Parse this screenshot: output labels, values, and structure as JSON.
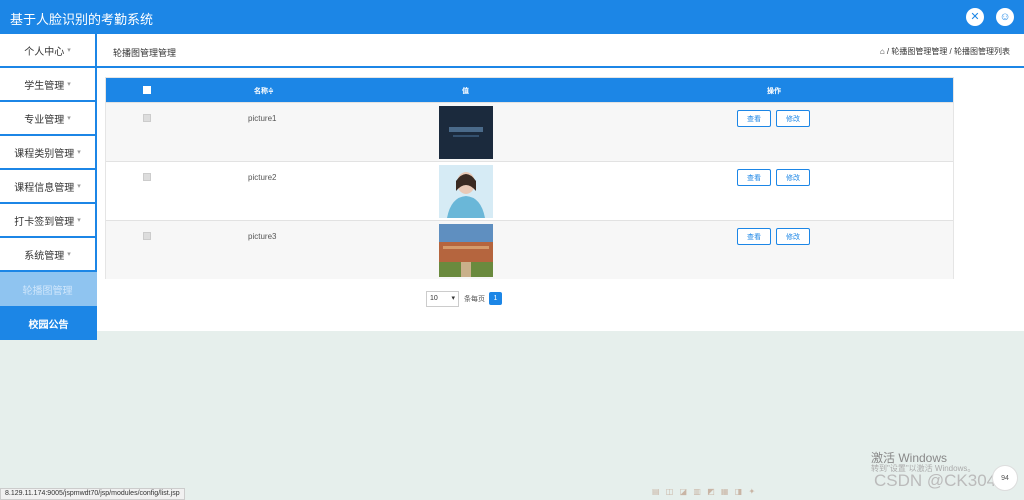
{
  "app": {
    "title": "基于人脸识别的考勤系统"
  },
  "header_icons": [
    "expand-icon",
    "user-icon"
  ],
  "sidebar": {
    "items": [
      {
        "label": "个人中心",
        "caret": "▾"
      },
      {
        "label": "学生管理",
        "caret": "▾"
      },
      {
        "label": "专业管理",
        "caret": "▾"
      },
      {
        "label": "课程类别管理",
        "caret": "▾"
      },
      {
        "label": "课程信息管理",
        "caret": "▾"
      },
      {
        "label": "打卡签到管理",
        "caret": "▾"
      },
      {
        "label": "系统管理",
        "caret": "▾"
      },
      {
        "label": "轮播图管理"
      },
      {
        "label": "校园公告"
      }
    ]
  },
  "page": {
    "title": "轮播图管理管理",
    "breadcrumb": "⌂ / 轮播图管理管理 / 轮播图管理列表"
  },
  "table": {
    "headers": {
      "name": "名称≑",
      "value": "值",
      "actions": "操作"
    },
    "rows": [
      {
        "name": "picture1",
        "image": "dark-banner-image"
      },
      {
        "name": "picture2",
        "image": "portrait-photo-image"
      },
      {
        "name": "picture3",
        "image": "campus-photo-image"
      }
    ],
    "view_label": "查看",
    "edit_label": "修改"
  },
  "pager": {
    "page_size": "10",
    "per_page_label": "条每页",
    "current_page": "1"
  },
  "status_url": "8.129.11.174:9005/jspmwdt70/jsp/modules/config/list.jsp",
  "watermark": {
    "title": "激活 Windows",
    "subtitle": "转到\"设置\"以激活 Windows。",
    "csdn": "CSDN @CK3043"
  },
  "float_button": "94",
  "colors": {
    "primary": "#1c86e6",
    "sidebar_active": "#8fc4f0",
    "page_bg": "#e6efec"
  }
}
